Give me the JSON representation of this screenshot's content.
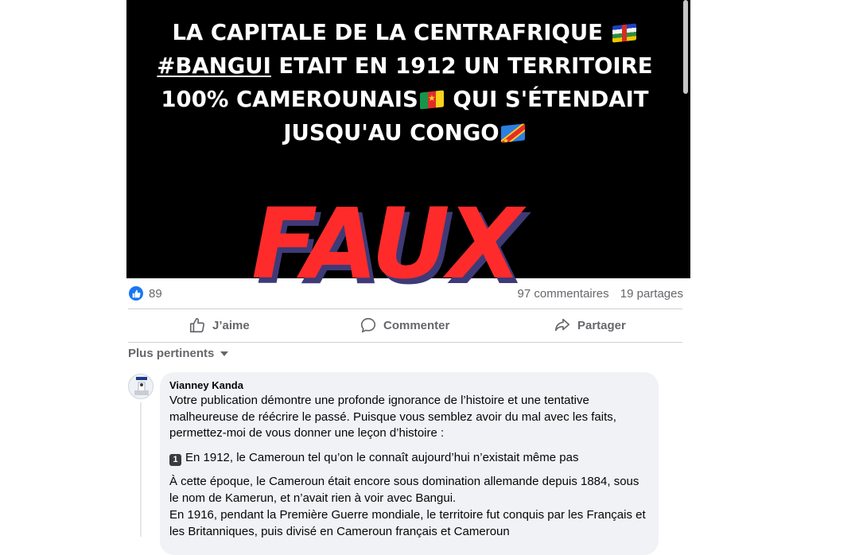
{
  "post": {
    "headline": {
      "line1": "LA CAPITALE DE LA CENTRAFRIQUE",
      "line2_hashtag": "#BANGUI",
      "line2_rest": " ETAIT EN 1912 UN TERRITOIRE",
      "line3_a": "100% CAMEROUNAIS",
      "line3_b": " QUI S'ÉTENDAIT",
      "line4": "JUSQU'AU CONGO"
    },
    "flags": [
      "central-african-republic-flag-icon",
      "cameroon-flag-icon",
      "dr-congo-flag-icon"
    ],
    "stamp": "FAUX"
  },
  "stats": {
    "reaction_count": "89",
    "comments": "97 commentaires",
    "shares": "19 partages"
  },
  "actions": {
    "like": "J’aime",
    "comment": "Commenter",
    "share": "Partager"
  },
  "sort": {
    "label": "Plus pertinents"
  },
  "comment": {
    "author": "Vianney Kanda",
    "p1": "Votre publication démontre une profonde ignorance de l’histoire et une tentative malheureuse de réécrire le passé. Puisque vous semblez avoir du mal avec les faits, permettez-moi de vous donner une leçon d’histoire :",
    "point1_number": "1",
    "point1": "En 1912, le Cameroun tel qu’on le connaît aujourd’hui n’existait même pas",
    "p2": "À cette époque, le Cameroun était encore sous domination allemande depuis 1884, sous le nom de Kamerun, et n’avait rien à voir avec Bangui.",
    "p3": "En 1916, pendant la Première Guerre mondiale, le territoire fut conquis par les Français et les Britanniques, puis divisé en Cameroun français et Cameroun"
  },
  "colors": {
    "stamp_red": "#ff2b2b",
    "stamp_shadow": "#3e3a77",
    "like_blue": "#1877f2",
    "muted_text": "#65676b",
    "bubble_bg": "#f0f2f5"
  }
}
